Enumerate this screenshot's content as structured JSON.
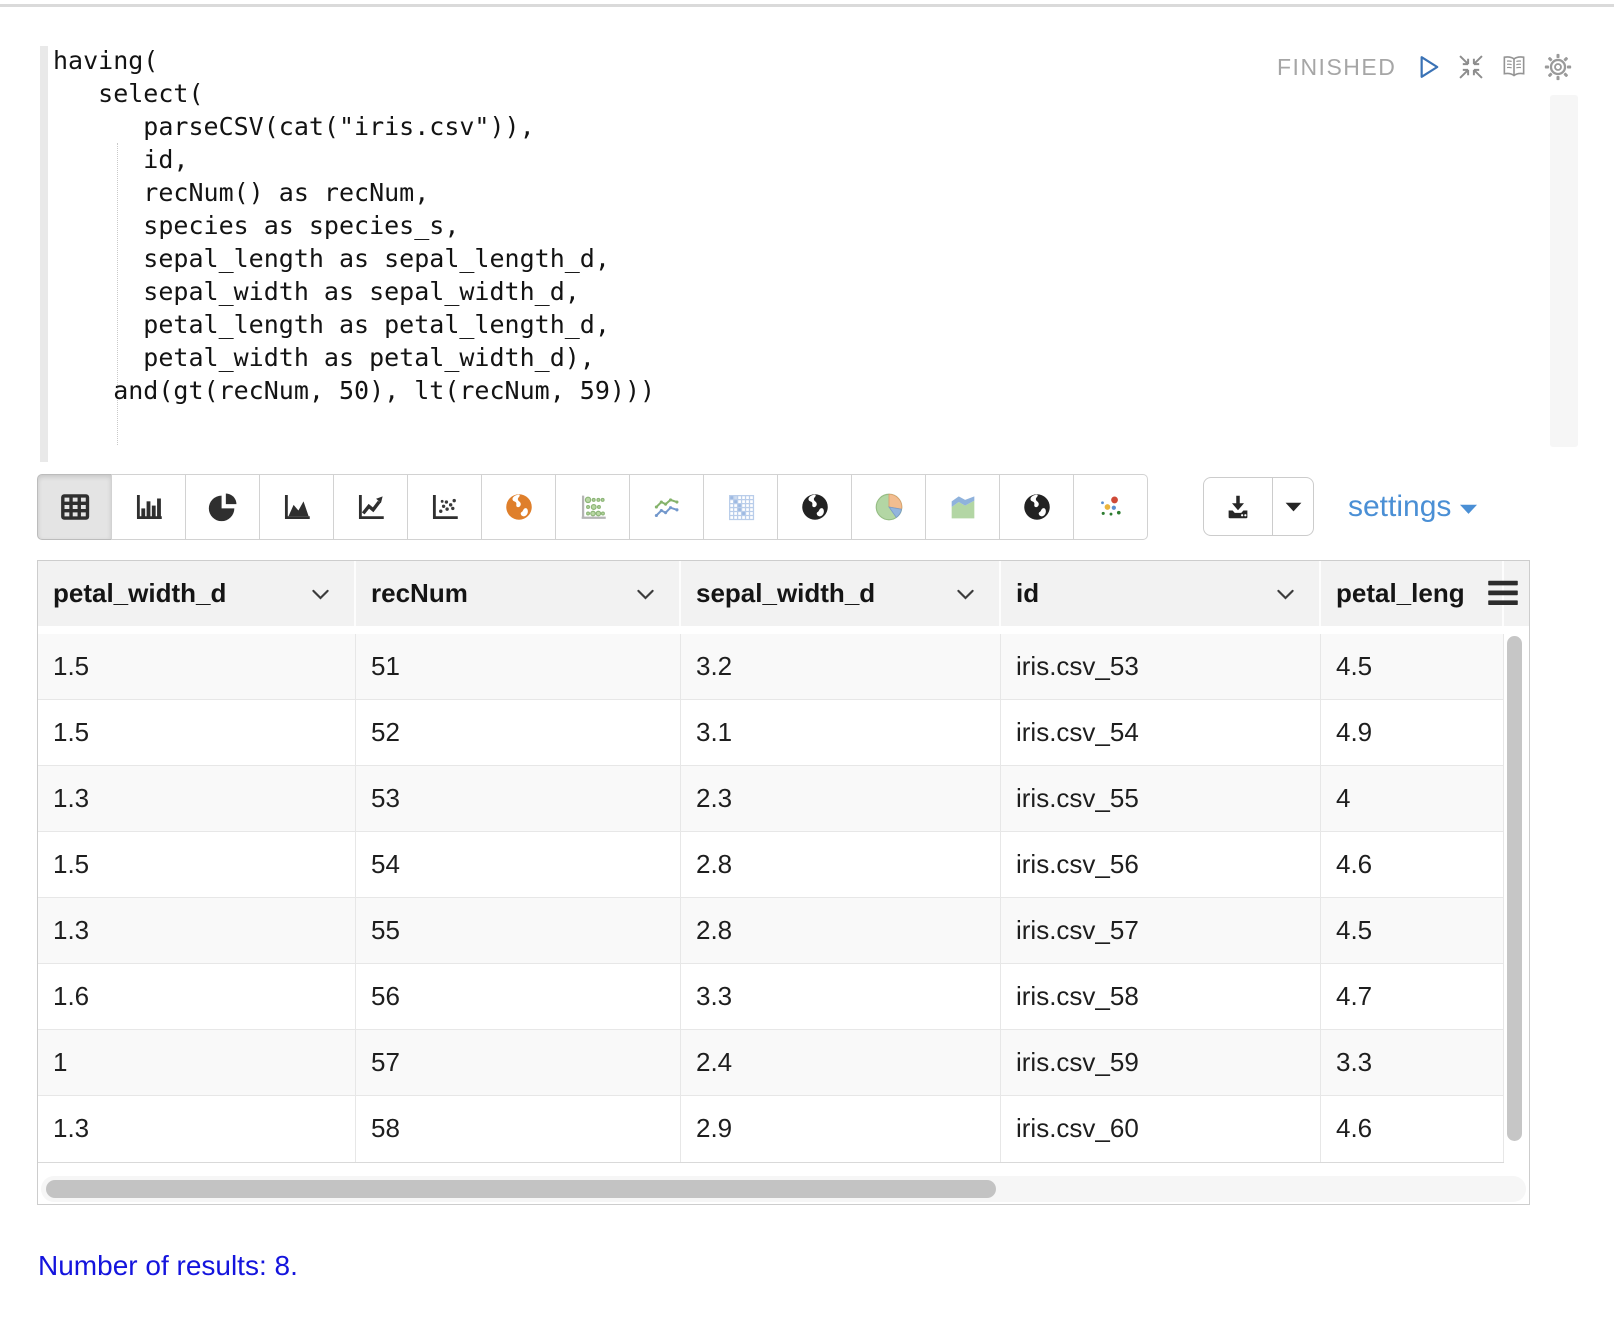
{
  "paragraph": {
    "status": "FINISHED",
    "code": "having(\n   select(\n      parseCSV(cat(\"iris.csv\")),\n      id,\n      recNum() as recNum,\n      species as species_s,\n      sepal_length as sepal_length_d,\n      sepal_width as sepal_width_d,\n      petal_length as petal_length_d,\n      petal_width as petal_width_d),\n    and(gt(recNum, 50), lt(recNum, 59)))"
  },
  "toolbar": {
    "chart_buttons": [
      {
        "icon": "table-chart",
        "selected": true
      },
      {
        "icon": "bar-chart",
        "selected": false
      },
      {
        "icon": "pie-chart",
        "selected": false
      },
      {
        "icon": "area-chart",
        "selected": false
      },
      {
        "icon": "line-chart",
        "selected": false
      },
      {
        "icon": "scatter-chart",
        "selected": false
      },
      {
        "icon": "map-globe-orange",
        "selected": false
      },
      {
        "icon": "bubble-matrix",
        "selected": false
      },
      {
        "icon": "multi-line-chart",
        "selected": false
      },
      {
        "icon": "heatmap",
        "selected": false
      },
      {
        "icon": "globe-dark-1",
        "selected": false
      },
      {
        "icon": "pie-pastel",
        "selected": false
      },
      {
        "icon": "stacked-area",
        "selected": false
      },
      {
        "icon": "globe-dark-2",
        "selected": false
      },
      {
        "icon": "colored-scatter",
        "selected": false
      }
    ],
    "settings_label": "settings"
  },
  "table": {
    "columns": [
      {
        "label": "petal_width_d",
        "sortable": true
      },
      {
        "label": "recNum",
        "sortable": true
      },
      {
        "label": "sepal_width_d",
        "sortable": true
      },
      {
        "label": "id",
        "sortable": true
      },
      {
        "label": "petal_leng",
        "sortable": false
      }
    ],
    "rows": [
      [
        "1.5",
        "51",
        "3.2",
        "iris.csv_53",
        "4.5"
      ],
      [
        "1.5",
        "52",
        "3.1",
        "iris.csv_54",
        "4.9"
      ],
      [
        "1.3",
        "53",
        "2.3",
        "iris.csv_55",
        "4"
      ],
      [
        "1.5",
        "54",
        "2.8",
        "iris.csv_56",
        "4.6"
      ],
      [
        "1.3",
        "55",
        "2.8",
        "iris.csv_57",
        "4.5"
      ],
      [
        "1.6",
        "56",
        "3.3",
        "iris.csv_58",
        "4.7"
      ],
      [
        "1",
        "57",
        "2.4",
        "iris.csv_59",
        "3.3"
      ],
      [
        "1.3",
        "58",
        "2.9",
        "iris.csv_60",
        "4.6"
      ]
    ]
  },
  "footer": {
    "results_text": "Number of results: 8."
  },
  "colors": {
    "play_accent": "#3a72b5",
    "settings_link": "#4a8fd5",
    "results_text": "#1414dd",
    "status_text": "#a6a6a6",
    "map_orange": "#df7f2b",
    "selected_button_bg": "#e4e4e4"
  }
}
